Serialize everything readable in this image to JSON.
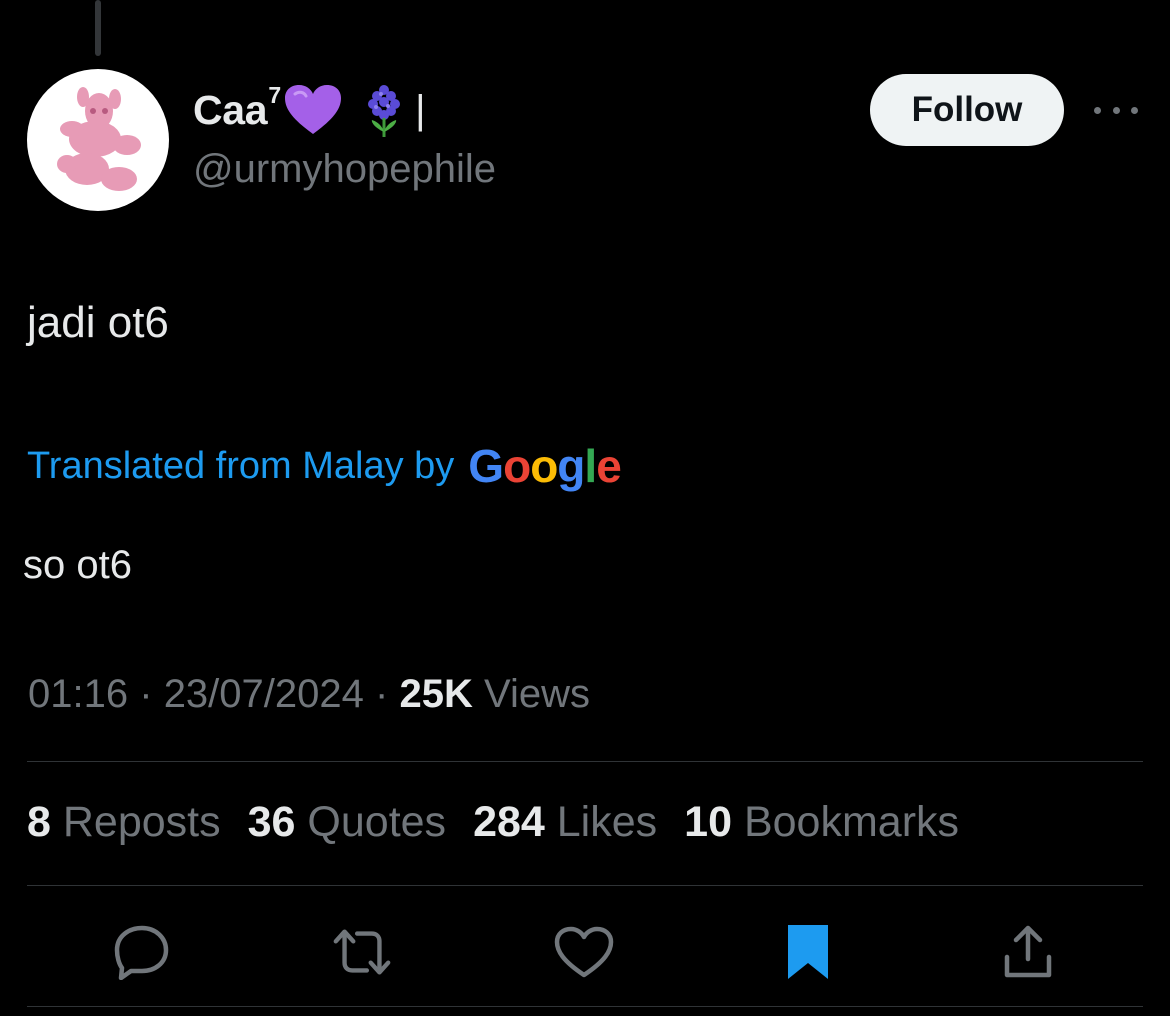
{
  "author": {
    "display_name": "Caa",
    "name_superscript": "7",
    "name_separator": "|",
    "handle": "@urmyhopephile",
    "avatar_icon": "pink-cartoon-avatar"
  },
  "header": {
    "follow_label": "Follow",
    "more_icon": "more-horizontal-icon"
  },
  "tweet": {
    "text": "jadi ot6",
    "translated_label": "Translated from Malay by",
    "translation_provider": {
      "g1": "G",
      "o1": "o",
      "o2": "o",
      "g2": "g",
      "l": "l",
      "e": "e"
    },
    "translation": "so ot6"
  },
  "meta": {
    "time": "01:16",
    "separator": "·",
    "date": "23/07/2024",
    "views_count": "25K",
    "views_label": "Views"
  },
  "stats": [
    {
      "count": "8",
      "label": "Reposts"
    },
    {
      "count": "36",
      "label": "Quotes"
    },
    {
      "count": "284",
      "label": "Likes"
    },
    {
      "count": "10",
      "label": "Bookmarks"
    }
  ],
  "actions": {
    "reply_icon": "reply-icon",
    "repost_icon": "repost-icon",
    "like_icon": "heart-icon",
    "bookmark_icon": "bookmark-icon",
    "share_icon": "share-icon"
  },
  "colors": {
    "background": "#000000",
    "text": "#e7e9ea",
    "muted": "#71767b",
    "link": "#1d9bf0",
    "bookmark_active": "#1d9bf0",
    "avatar_pink": "#e79bb6"
  }
}
